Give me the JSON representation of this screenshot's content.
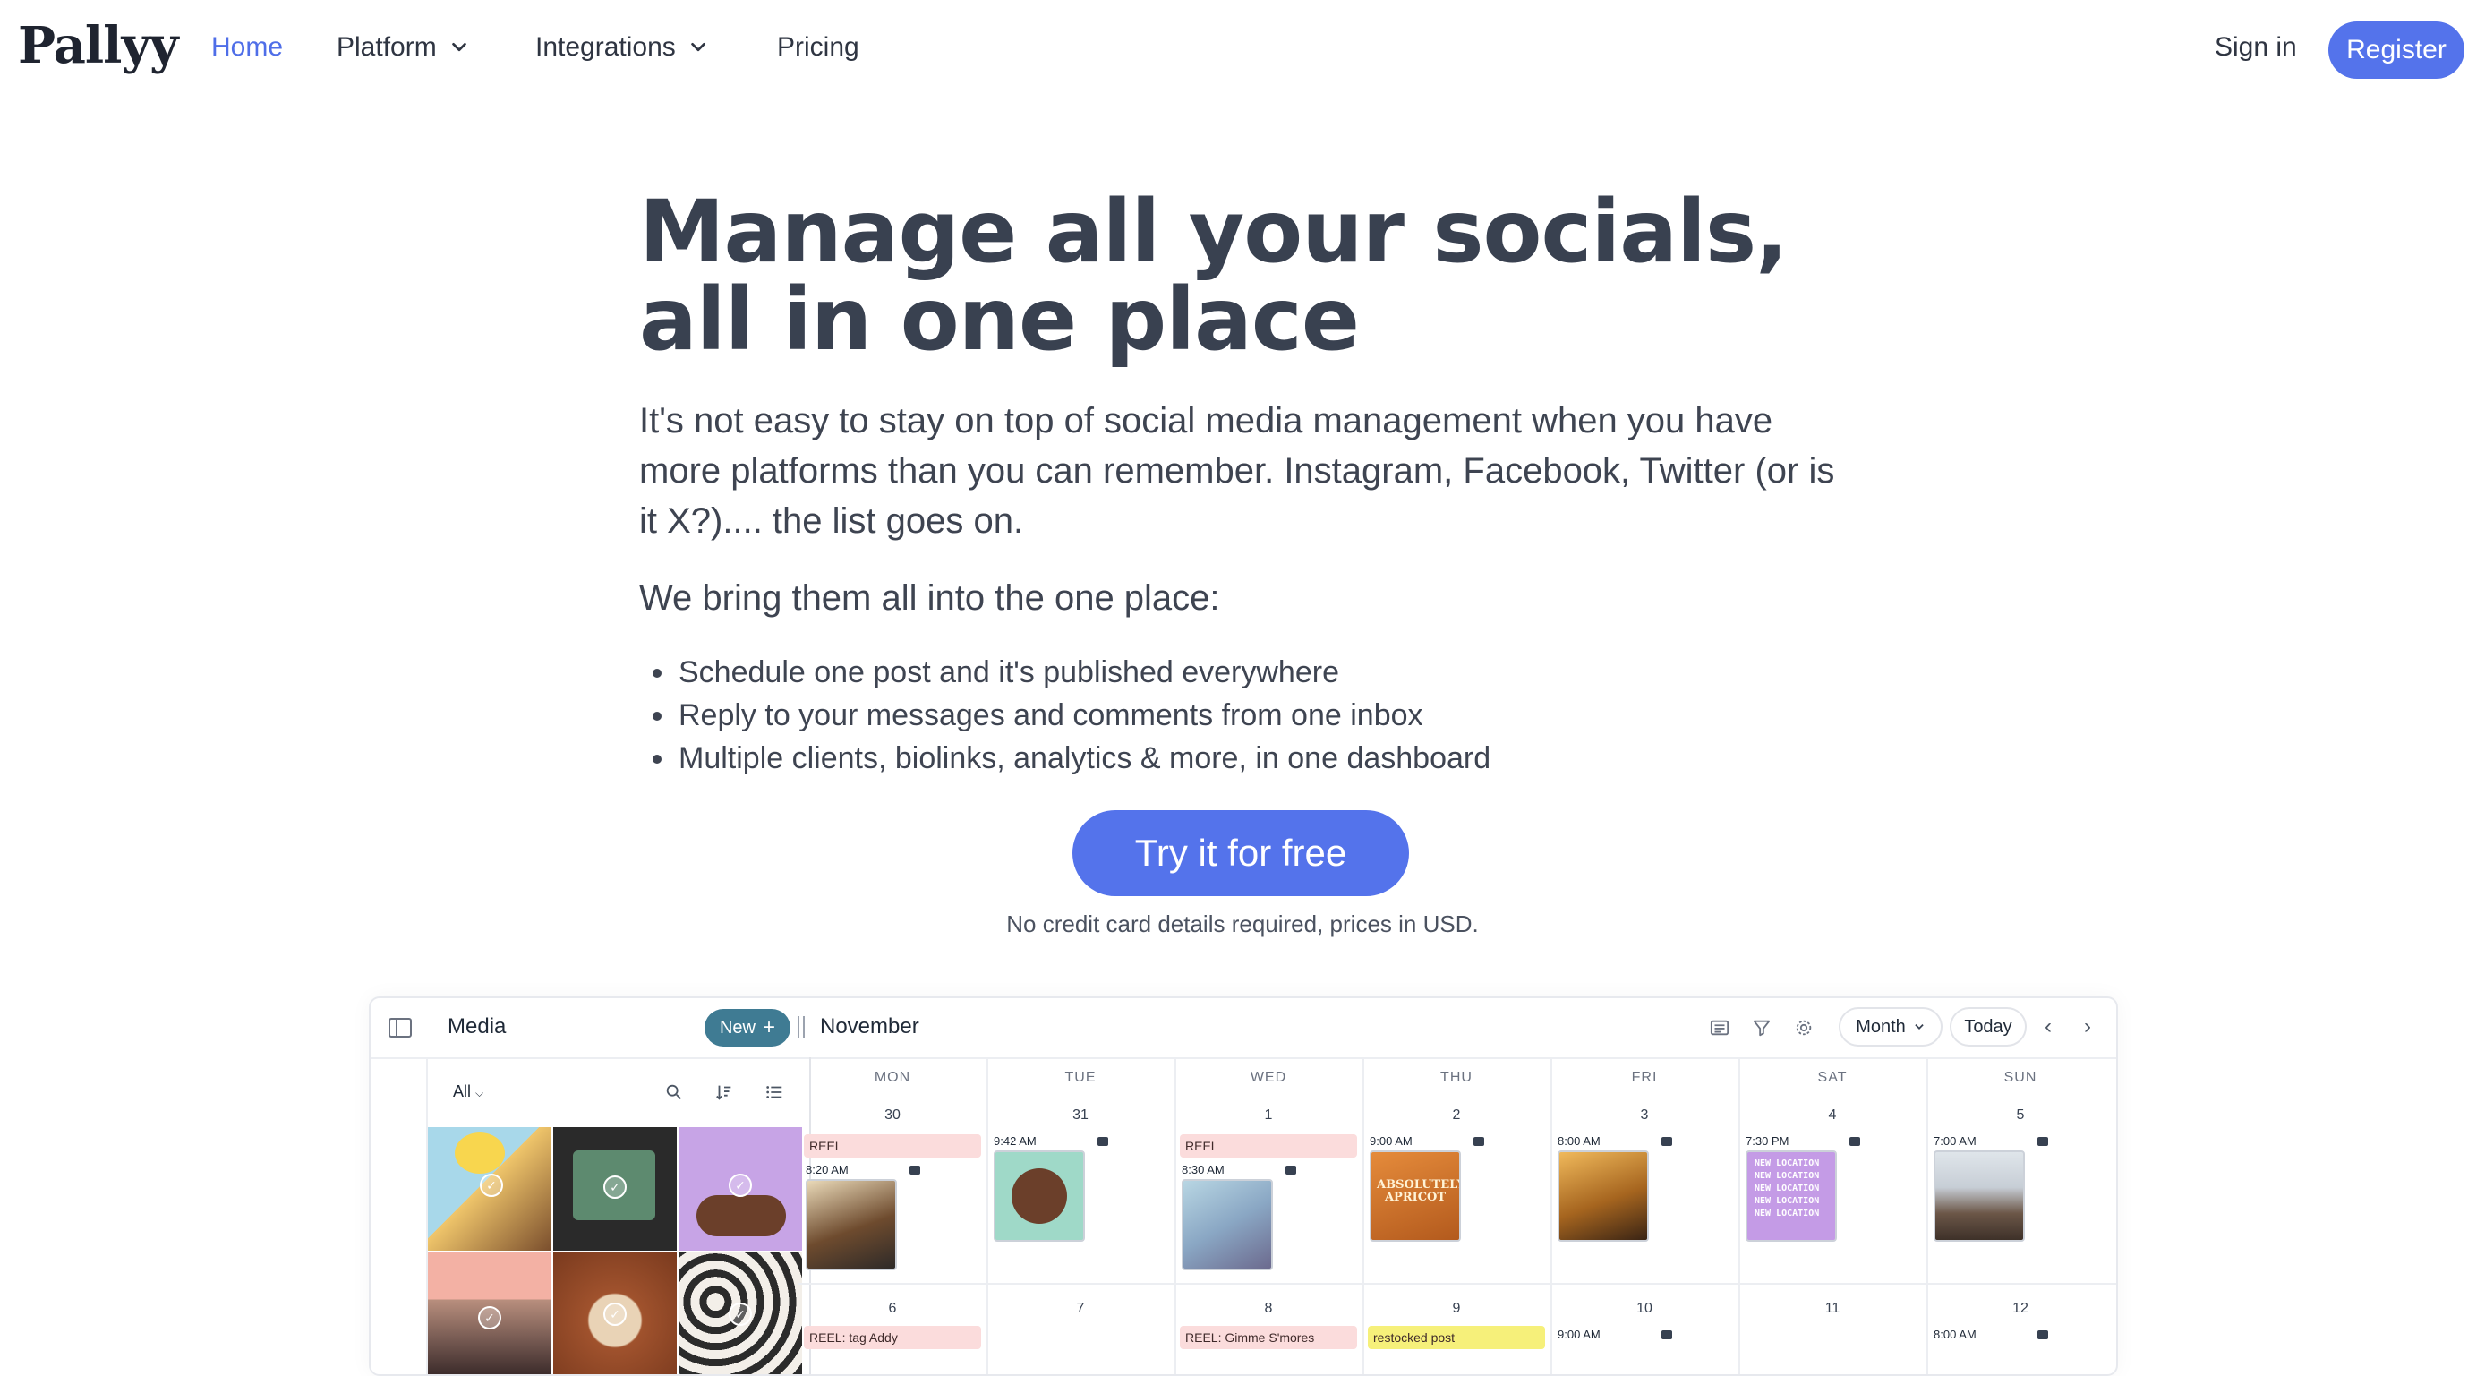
{
  "nav": {
    "logo": "Pallyy",
    "links": [
      "Home",
      "Platform",
      "Integrations",
      "Pricing"
    ],
    "sign_in": "Sign in",
    "register": "Register"
  },
  "hero": {
    "title": "Manage all your socials, all in one place",
    "lead": "It's not easy to stay on top of social media management when you have more platforms than you can remember. Instagram, Facebook, Twitter (or is it X?).... the list goes on.",
    "subheading": "We bring them all into the one place:",
    "bullets": [
      "Schedule one post and it's published everywhere",
      "Reply to your messages and comments from one inbox",
      "Multiple clients, biolinks, analytics & more, in one dashboard"
    ],
    "cta": "Try it for free",
    "note": "No credit card details required, prices in USD."
  },
  "app": {
    "media_title": "Media",
    "new_label": "New",
    "month_title": "November",
    "view_select": "Month",
    "today_label": "Today",
    "filter_label": "All",
    "days": [
      "MON",
      "TUE",
      "WED",
      "THU",
      "FRI",
      "SAT",
      "SUN"
    ],
    "week1": {
      "dates": [
        "30",
        "31",
        "1",
        "2",
        "3",
        "4",
        "5"
      ],
      "mon_tag": "REEL",
      "mon_time": "8:20 AM",
      "tue_time": "9:42 AM",
      "wed_tag": "REEL",
      "wed_time": "8:30 AM",
      "thu_time": "9:00 AM",
      "fri_time": "8:00 AM",
      "sat_time": "7:30 PM",
      "sun_time": "7:00 AM",
      "thu_post_text": "ABSOLUTELY APRICOT",
      "sat_post_text": "NEW LOCATION NEW LOCATION NEW LOCATION NEW LOCATION NEW LOCATION"
    },
    "week2": {
      "dates": [
        "6",
        "7",
        "8",
        "9",
        "10",
        "11",
        "12"
      ],
      "mon_tag": "REEL: tag Addy",
      "wed_tag": "REEL: Gimme S'mores",
      "thu_tag": "restocked post",
      "fri_time": "9:00 AM",
      "sun_time": "8:00 AM"
    },
    "colors": {
      "accent": "#5473eb",
      "new_button": "#3f7b93",
      "reel_tag": "#fbdcdc",
      "restock_tag": "#f6f07a"
    }
  }
}
